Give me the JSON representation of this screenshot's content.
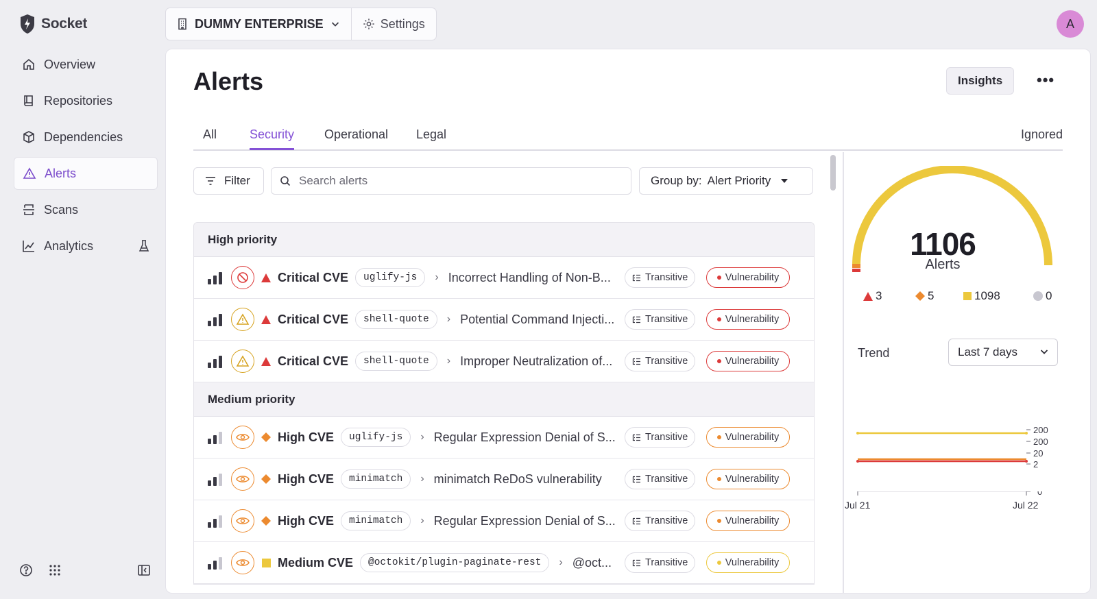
{
  "app": {
    "name": "Socket"
  },
  "sidebar": {
    "items": [
      {
        "label": "Overview",
        "icon": "home-icon"
      },
      {
        "label": "Repositories",
        "icon": "book-icon"
      },
      {
        "label": "Dependencies",
        "icon": "package-icon"
      },
      {
        "label": "Alerts",
        "icon": "alert-triangle-icon",
        "active": true
      },
      {
        "label": "Scans",
        "icon": "scan-icon"
      },
      {
        "label": "Analytics",
        "icon": "chart-line-icon",
        "badge_icon": "beaker-icon"
      }
    ]
  },
  "topbar": {
    "org_name": "DUMMY ENTERPRISE",
    "settings_label": "Settings",
    "avatar_initial": "A"
  },
  "page": {
    "title": "Alerts",
    "insights_label": "Insights",
    "more_label": "•••"
  },
  "tabs": {
    "all": "All",
    "security": "Security",
    "operational": "Operational",
    "legal": "Legal",
    "ignored": "Ignored",
    "active": "Security"
  },
  "toolbar": {
    "filter_label": "Filter",
    "search_placeholder": "Search alerts",
    "groupby_label": "Group by:",
    "groupby_value": "Alert Priority"
  },
  "groups": {
    "high": {
      "label": "High priority"
    },
    "medium": {
      "label": "Medium priority"
    }
  },
  "rows": [
    {
      "cve": "Critical CVE",
      "pkg": "uglify-js",
      "title": "Incorrect Handling of Non-B...",
      "dep": "Transitive",
      "category": "Vulnerability",
      "severity": "critical",
      "action": "block"
    },
    {
      "cve": "Critical CVE",
      "pkg": "shell-quote",
      "title": "Potential Command Injecti...",
      "dep": "Transitive",
      "category": "Vulnerability",
      "severity": "critical",
      "action": "warn"
    },
    {
      "cve": "Critical CVE",
      "pkg": "shell-quote",
      "title": "Improper Neutralization of...",
      "dep": "Transitive",
      "category": "Vulnerability",
      "severity": "critical",
      "action": "warn"
    },
    {
      "cve": "High CVE",
      "pkg": "uglify-js",
      "title": "Regular Expression Denial of S...",
      "dep": "Transitive",
      "category": "Vulnerability",
      "severity": "high",
      "action": "monitor"
    },
    {
      "cve": "High CVE",
      "pkg": "minimatch",
      "title": "minimatch ReDoS vulnerability",
      "dep": "Transitive",
      "category": "Vulnerability",
      "severity": "high",
      "action": "monitor"
    },
    {
      "cve": "High CVE",
      "pkg": "minimatch",
      "title": "Regular Expression Denial of S...",
      "dep": "Transitive",
      "category": "Vulnerability",
      "severity": "high",
      "action": "monitor"
    },
    {
      "cve": "Medium CVE",
      "pkg": "@octokit/plugin-paginate-rest",
      "title": "@oct...",
      "dep": "Transitive",
      "category": "Vulnerability",
      "severity": "medium",
      "action": "monitor"
    }
  ],
  "summary": {
    "total": "1106",
    "total_label": "Alerts",
    "critical": "3",
    "high": "5",
    "medium": "1098",
    "low": "0"
  },
  "trend": {
    "label": "Trend",
    "range": "Last 7 days",
    "x_start": "Jul 21",
    "x_end": "Jul 22",
    "y_ticks": [
      "200",
      "200",
      "20",
      "2",
      "0"
    ]
  },
  "colors": {
    "accent": "#8451d6",
    "critical": "#dc3a3a",
    "high": "#ec8a2f",
    "medium": "#ecc83d",
    "low": "#c8c7d0"
  }
}
